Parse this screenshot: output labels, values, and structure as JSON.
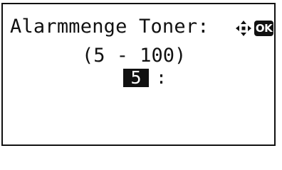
{
  "screen": {
    "title": "Alarmmenge Toner:",
    "range_text": "(5 - 100)",
    "input_value": "5",
    "separator": ":"
  },
  "navigation": {
    "arrows_icon": "four-way-arrow-icon",
    "ok_label": "OK"
  },
  "colors": {
    "foreground": "#111111",
    "background": "#ffffff",
    "highlight": "#111111"
  }
}
